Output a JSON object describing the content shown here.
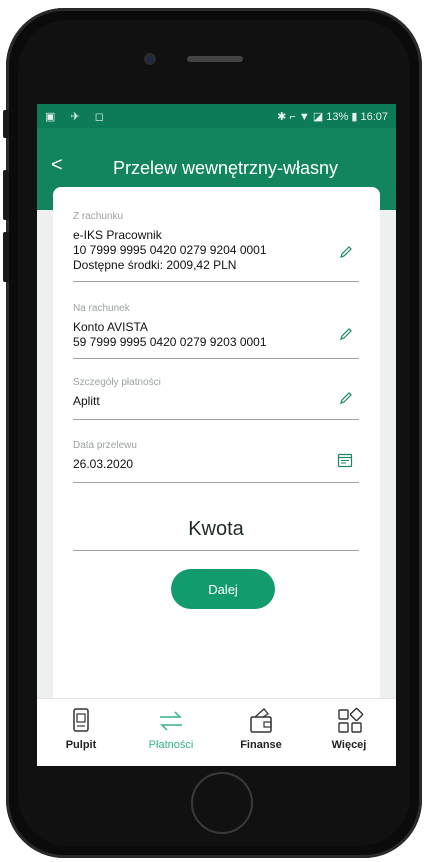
{
  "statusbar": {
    "left": "▣ ✈ ◻",
    "right": "✱ ⌐ ▼ ◪ 13% ▮ 16:07"
  },
  "header": {
    "title": "Przelew wewnętrzny-własny",
    "back": "<"
  },
  "form": {
    "from_label": "Z rachunku",
    "from_name": "e-IKS Pracownik",
    "from_number": "10 7999 9995 0420 0279 9204 0001",
    "from_available": "Dostępne środki: 2009,42 PLN",
    "to_label": "Na rachunek",
    "to_name": "Konto AVISTA",
    "to_number": "59 7999 9995 0420 0279 9203 0001",
    "details_label": "Szczegóły płatności",
    "details_value": "Aplitt",
    "date_label": "Data przelewu",
    "date_value": "26.03.2020",
    "amount_label": "Kwota",
    "next_button": "Dalej"
  },
  "nav": [
    {
      "label": "Pulpit",
      "icon": "dashboard-icon",
      "active": false
    },
    {
      "label": "Płatności",
      "icon": "transfer-icon",
      "active": true
    },
    {
      "label": "Finanse",
      "icon": "wallet-icon",
      "active": false
    },
    {
      "label": "Więcej",
      "icon": "grid-icon",
      "active": false
    }
  ],
  "colors": {
    "brand": "#12855f",
    "button": "#129b6c",
    "active_nav": "#35b28a"
  }
}
